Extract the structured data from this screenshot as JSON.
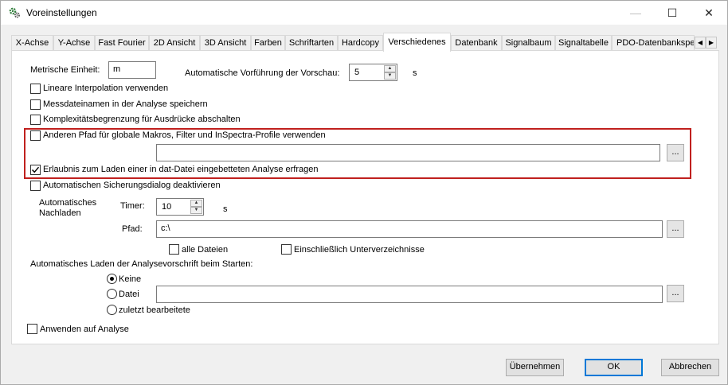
{
  "window": {
    "title": "Voreinstellungen",
    "minimize": "—",
    "maximize": "☐",
    "close": "✕"
  },
  "tabs": [
    {
      "label": "X-Achse"
    },
    {
      "label": "Y-Achse"
    },
    {
      "label": "Fast Fourier"
    },
    {
      "label": "2D Ansicht"
    },
    {
      "label": "3D Ansicht"
    },
    {
      "label": "Farben"
    },
    {
      "label": "Schriftarten"
    },
    {
      "label": "Hardcopy"
    },
    {
      "label": "Verschiedenes"
    },
    {
      "label": "Datenbank"
    },
    {
      "label": "Signalbaum"
    },
    {
      "label": "Signaltabelle"
    },
    {
      "label": "PDO-Datenbankspe"
    }
  ],
  "active_tab": "Verschiedenes",
  "tab_scroll": {
    "left": "◀",
    "right": "▶"
  },
  "general": {
    "metric_unit_label": "Metrische Einheit:",
    "metric_unit_value": "m",
    "preview_label": "Automatische Vorführung der Vorschau:",
    "preview_value": "5",
    "preview_unit": "s"
  },
  "checkboxes": {
    "linear": {
      "label": "Lineare Interpolation verwenden",
      "checked": false
    },
    "save_names": {
      "label": "Messdateinamen in der Analyse speichern",
      "checked": false
    },
    "complexity": {
      "label": "Komplexitätsbegrenzung für Ausdrücke abschalten",
      "checked": false
    },
    "other_path": {
      "label": "Anderen Pfad für globale Makros, Filter und InSpectra-Profile verwenden",
      "checked": false
    },
    "permission": {
      "label": "Erlaubnis zum Laden einer in dat-Datei eingebetteten Analyse erfragen",
      "checked": true
    },
    "backup": {
      "label": "Automatischen Sicherungsdialog deaktivieren",
      "checked": false
    },
    "all_files": {
      "label": "alle Dateien",
      "checked": false
    },
    "subdirs": {
      "label": "Einschließlich Unterverzeichnisse",
      "checked": false
    },
    "apply": {
      "label": "Anwenden auf Analyse",
      "checked": false
    }
  },
  "global_path_value": "",
  "autoload": {
    "label": "Automatisches Nachladen",
    "timer_label": "Timer:",
    "timer_value": "10",
    "timer_unit": "s",
    "path_label": "Pfad:",
    "path_value": "c:\\"
  },
  "startup": {
    "label": "Automatisches Laden der Analysevorschrift beim Starten:",
    "options": [
      {
        "label": "Keine",
        "selected": true
      },
      {
        "label": "Datei",
        "selected": false
      },
      {
        "label": "zuletzt bearbeitete",
        "selected": false
      }
    ],
    "file_value": ""
  },
  "browse_label": "...",
  "buttons": {
    "apply": "Übernehmen",
    "ok": "OK",
    "cancel": "Abbrechen"
  }
}
